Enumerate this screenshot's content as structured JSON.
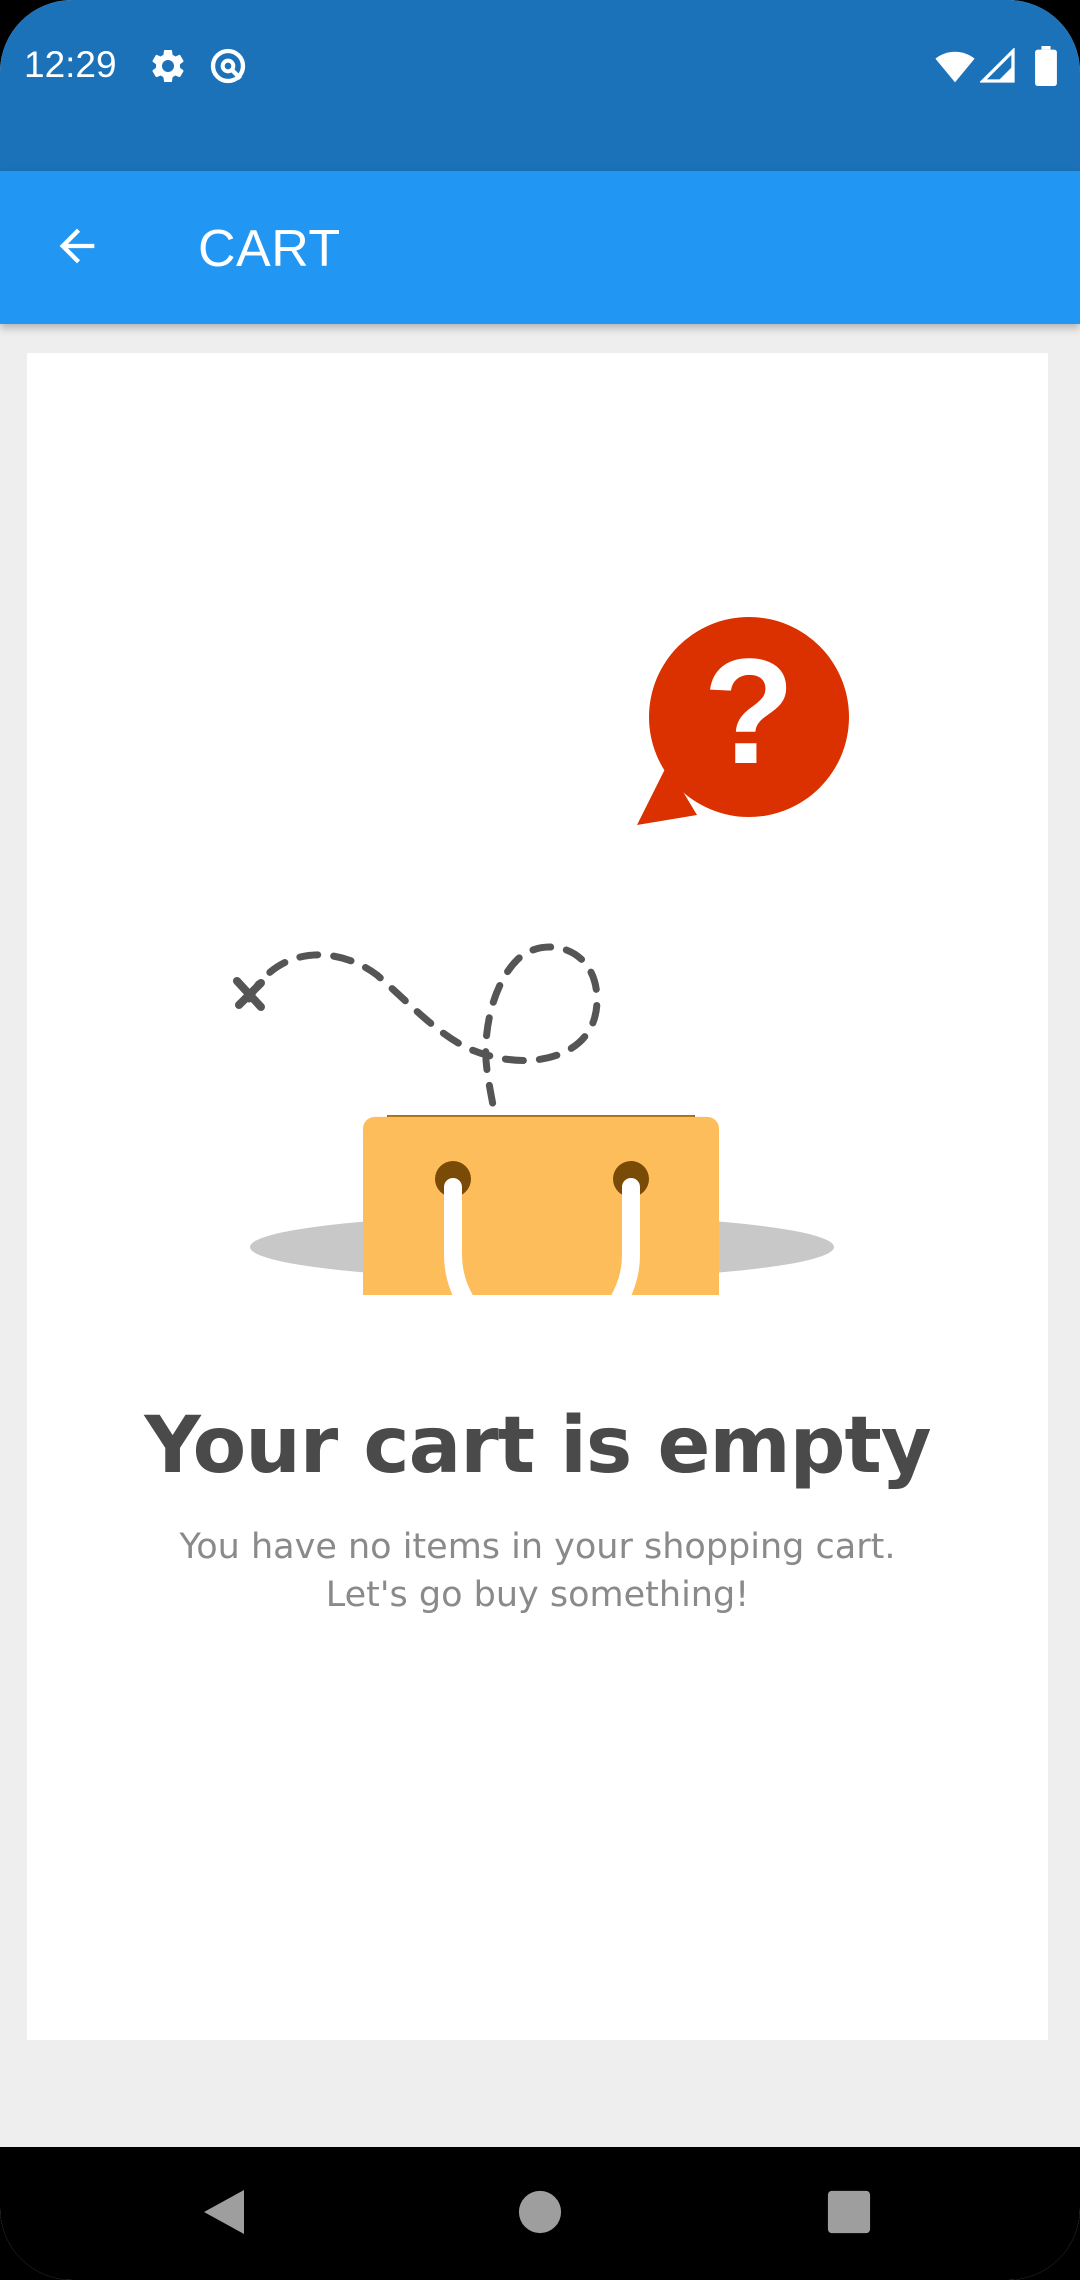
{
  "status_bar": {
    "time": "12:29",
    "left_icons": [
      "settings-icon",
      "vpn-key-icon"
    ],
    "right_icons": [
      "wifi-icon",
      "cell-signal-icon",
      "battery-icon"
    ],
    "background_color": "#1b72b8"
  },
  "app_bar": {
    "back_icon": "arrow-left-icon",
    "title": "CART",
    "background_color": "#2196f3"
  },
  "empty_state": {
    "illustration": "empty-shopping-bag-with-question-mark",
    "title": "Your cart is empty",
    "subtitle_line1": "You have no items in your shopping cart.",
    "subtitle_line2": "Let's go buy something!",
    "accent_color": "#db3100",
    "bag_color": "#fdbd5b"
  },
  "nav_bar": {
    "buttons": [
      "back-triangle-icon",
      "home-circle-icon",
      "recents-square-icon"
    ]
  }
}
